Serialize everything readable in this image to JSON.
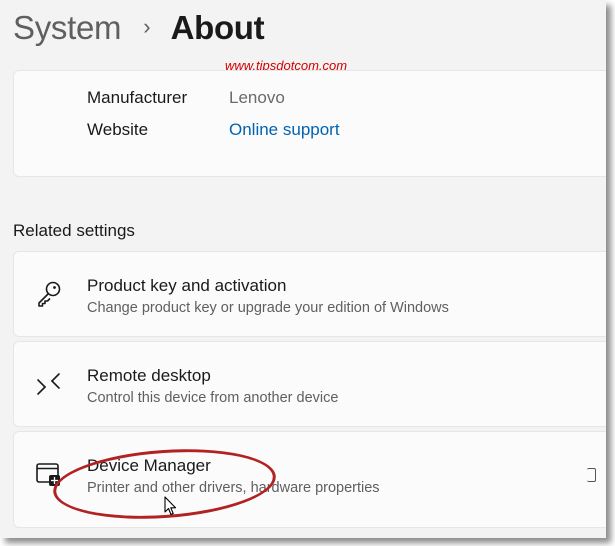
{
  "breadcrumb": {
    "parent": "System",
    "separator": "›",
    "current": "About"
  },
  "watermark": "www.tipsdotcom.com",
  "device_info": {
    "rows": [
      {
        "label": "Manufacturer",
        "value": "Lenovo"
      },
      {
        "label": "Website",
        "value": "Online support"
      }
    ]
  },
  "related_settings": {
    "title": "Related settings",
    "items": [
      {
        "title": "Product key and activation",
        "desc": "Change product key or upgrade your edition of Windows",
        "icon": "key-icon"
      },
      {
        "title": "Remote desktop",
        "desc": "Control this device from another device",
        "icon": "remote-desktop-icon"
      },
      {
        "title": "Device Manager",
        "desc": "Printer and other drivers, hardware properties",
        "icon": "device-manager-icon"
      }
    ]
  },
  "colors": {
    "accent_link": "#0063b1",
    "annotation": "#b22222",
    "watermark": "#d40000"
  }
}
